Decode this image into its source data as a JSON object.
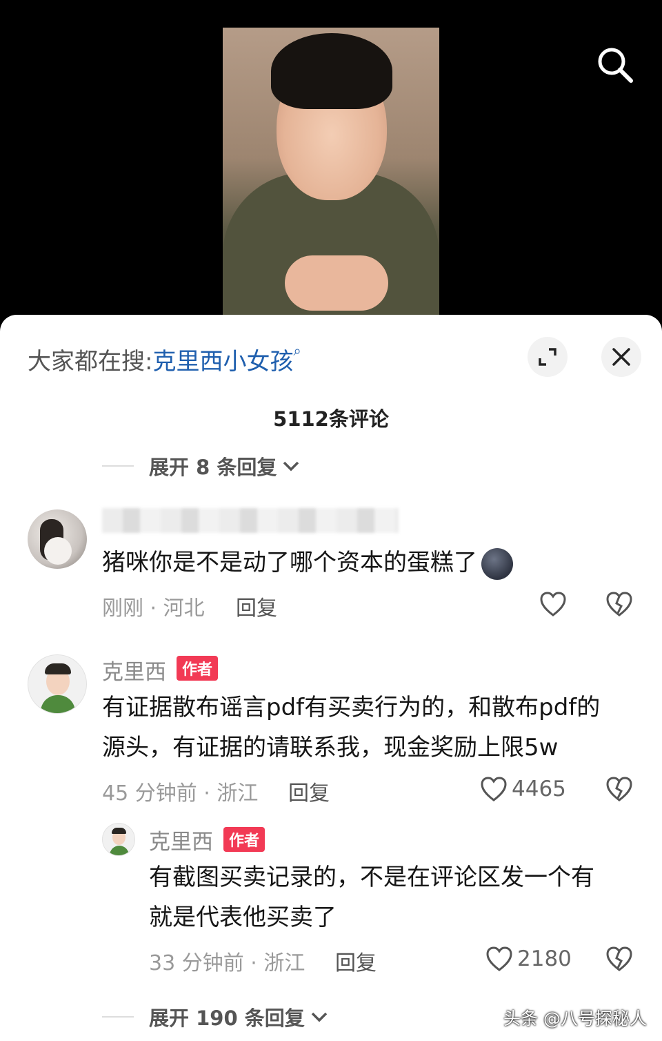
{
  "search": {
    "icon": "search-icon"
  },
  "sheet": {
    "trending_prefix": "大家都在搜:",
    "trending_keyword": "克里西小女孩",
    "comment_count": "5112条评论"
  },
  "expand_top": "展开 8 条回复",
  "comments": [
    {
      "text": "猪咪你是不是动了哪个资本的蛋糕了",
      "meta": "刚刚 · 河北",
      "reply": "回复"
    },
    {
      "author": "克里西",
      "badge": "作者",
      "line1": "有证据散布谣言pdf有买卖行为的，和散布pdf的",
      "line2": "源头，有证据的请联系我，现金奖励上限5w",
      "meta": "45 分钟前 · 浙江",
      "reply": "回复",
      "likes": "4465"
    }
  ],
  "subreply": {
    "author": "克里西",
    "badge": "作者",
    "line1": "有截图买卖记录的，不是在评论区发一个有",
    "line2": "就是代表他买卖了",
    "meta": "33 分钟前 · 浙江",
    "reply": "回复",
    "likes": "2180"
  },
  "expand_bottom": "展开 190 条回复",
  "watermark": "头条 @八号探秘人",
  "colors": {
    "badge": "#f23a55",
    "keyword": "#1f5fae"
  }
}
